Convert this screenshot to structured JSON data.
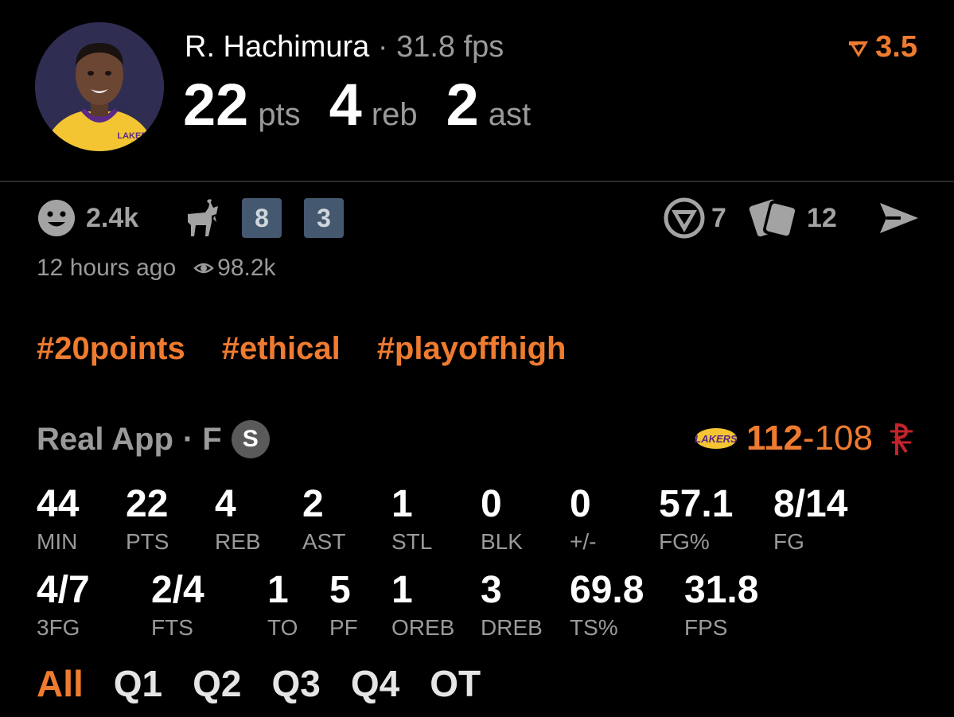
{
  "player": {
    "name": "R. Hachimura",
    "separator": "·",
    "fps_text": "31.8 fps",
    "jersey_text": "LAKERS"
  },
  "headline": {
    "pts_value": "22",
    "pts_unit": "pts",
    "reb_value": "4",
    "reb_unit": "reb",
    "ast_value": "2",
    "ast_unit": "ast"
  },
  "bet": {
    "icon": "prop-arrow-icon",
    "value": "3.5",
    "color": "#ee7b30"
  },
  "reactions": {
    "smile_icon": "smile-icon",
    "smile_count": "2.4k",
    "goat_icon": "goat-icon",
    "badge_1": "8",
    "badge_2": "3",
    "prediction_count": "7",
    "cards_count": "12",
    "share_icon": "share-icon"
  },
  "meta": {
    "time_ago": "12 hours ago",
    "views": "98.2k"
  },
  "hashtags": [
    "#20points",
    "#ethical",
    "#playoffhigh"
  ],
  "game": {
    "source": "Real App",
    "status": "· F",
    "s_badge": "S",
    "home_logo_text": "LAKERS",
    "home_score": "112",
    "dash": "-",
    "away_score": "108"
  },
  "box_score": {
    "row1": [
      {
        "value": "44",
        "label": "MIN"
      },
      {
        "value": "22",
        "label": "PTS"
      },
      {
        "value": "4",
        "label": "REB"
      },
      {
        "value": "2",
        "label": "AST"
      },
      {
        "value": "1",
        "label": "STL"
      },
      {
        "value": "0",
        "label": "BLK"
      },
      {
        "value": "0",
        "label": "+/-"
      },
      {
        "value": "57.1",
        "label": "FG%"
      },
      {
        "value": "8/14",
        "label": "FG"
      }
    ],
    "row2": [
      {
        "value": "4/7",
        "label": "3FG"
      },
      {
        "value": "2/4",
        "label": "FTS"
      },
      {
        "value": "1",
        "label": "TO"
      },
      {
        "value": "5",
        "label": "PF"
      },
      {
        "value": "1",
        "label": "OREB"
      },
      {
        "value": "3",
        "label": "DREB"
      },
      {
        "value": "69.8",
        "label": "TS%"
      },
      {
        "value": "31.8",
        "label": "FPS"
      }
    ]
  },
  "periods": [
    {
      "label": "All",
      "active": true
    },
    {
      "label": "Q1",
      "active": false
    },
    {
      "label": "Q2",
      "active": false
    },
    {
      "label": "Q3",
      "active": false
    },
    {
      "label": "Q4",
      "active": false
    },
    {
      "label": "OT",
      "active": false
    }
  ],
  "colors": {
    "accent": "#ee7b30",
    "background": "#000000",
    "muted": "#9a9a9a",
    "badge": "#44586f"
  }
}
